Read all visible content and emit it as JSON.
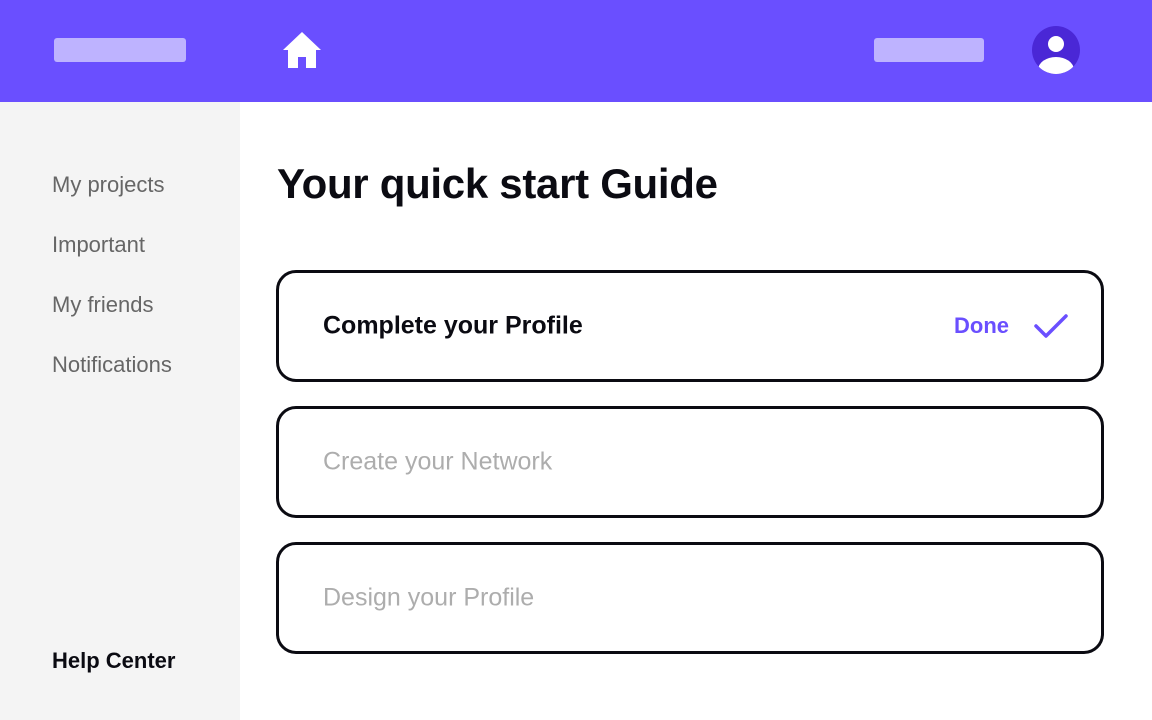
{
  "header": {
    "background_color": "#6a4fff",
    "placeholder_color": "#beb3ff",
    "home_icon": "home-icon",
    "avatar_icon": "user-avatar-icon",
    "avatar_color": "#4a27d6"
  },
  "sidebar": {
    "items": [
      {
        "label": "My projects"
      },
      {
        "label": "Important"
      },
      {
        "label": "My friends"
      },
      {
        "label": "Notifications"
      }
    ],
    "help_label": "Help Center"
  },
  "main": {
    "title": "Your quick start Guide",
    "steps": [
      {
        "label": "Complete your Profile",
        "status": "Done",
        "completed": true,
        "status_icon": "checkmark-icon"
      },
      {
        "label": "Create your Network",
        "status": "",
        "completed": false
      },
      {
        "label": "Design your Profile",
        "status": "",
        "completed": false
      }
    ]
  },
  "colors": {
    "accent": "#6a4fff",
    "text_primary": "#0b0b12",
    "text_muted": "#666666",
    "text_disabled": "#adadad",
    "sidebar_bg": "#f4f4f4"
  }
}
